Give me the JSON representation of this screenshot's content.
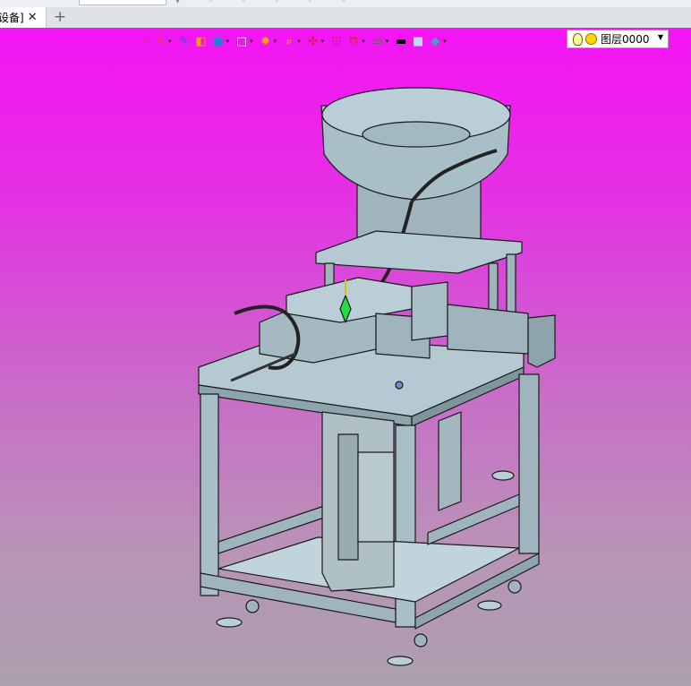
{
  "tabs": [
    {
      "title": "设备]",
      "close": "✕"
    }
  ],
  "tab_add": "+",
  "toolbar": {
    "buttons": [
      {
        "icon": "exit-icon",
        "color": "#e0308a",
        "dropdown": false
      },
      {
        "icon": "user-settings-icon",
        "color": "#e05000",
        "dropdown": true
      },
      {
        "icon": "pen-icon",
        "color": "#2060d0",
        "dropdown": false
      },
      {
        "icon": "shaded-box-icon",
        "color": "#f0a000",
        "dropdown": false
      },
      {
        "icon": "view-cube-icon",
        "color": "#2a7fd4",
        "dropdown": true
      },
      {
        "icon": "wire-cube-icon",
        "color": "#ffffff",
        "dropdown": true
      },
      {
        "icon": "render-icon",
        "color": "#ffa500",
        "dropdown": true
      },
      {
        "icon": "zoom-icon",
        "color": "#e0c000",
        "dropdown": true
      },
      {
        "icon": "pan-icon",
        "color": "#e02020",
        "dropdown": true
      },
      {
        "icon": "section-icon",
        "color": "#c02080",
        "dropdown": false
      },
      {
        "icon": "dimension-icon",
        "color": "#d02020",
        "dropdown": true
      },
      {
        "icon": "display-icon",
        "color": "#606060",
        "dropdown": true
      },
      {
        "icon": "line-color-icon",
        "color": "#000000",
        "dropdown": false
      },
      {
        "icon": "fill-color-icon",
        "color": "#c0d8ff",
        "dropdown": false
      },
      {
        "icon": "layers-icon",
        "color": "#4aa0c0",
        "dropdown": true
      }
    ]
  },
  "layer_select": {
    "value": "图层0000"
  }
}
